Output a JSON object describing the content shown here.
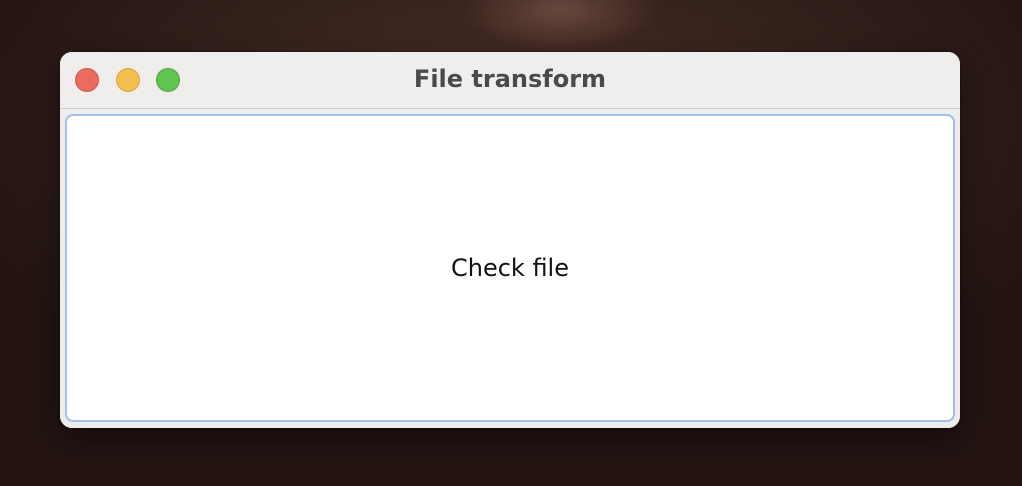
{
  "window": {
    "title": "File transform",
    "controls": {
      "close_color": "#ec6a5e",
      "minimize_color": "#f4bf4f",
      "zoom_color": "#61c554"
    }
  },
  "main": {
    "button_label": "Check file",
    "focus_ring_color": "#9cc2ec"
  }
}
